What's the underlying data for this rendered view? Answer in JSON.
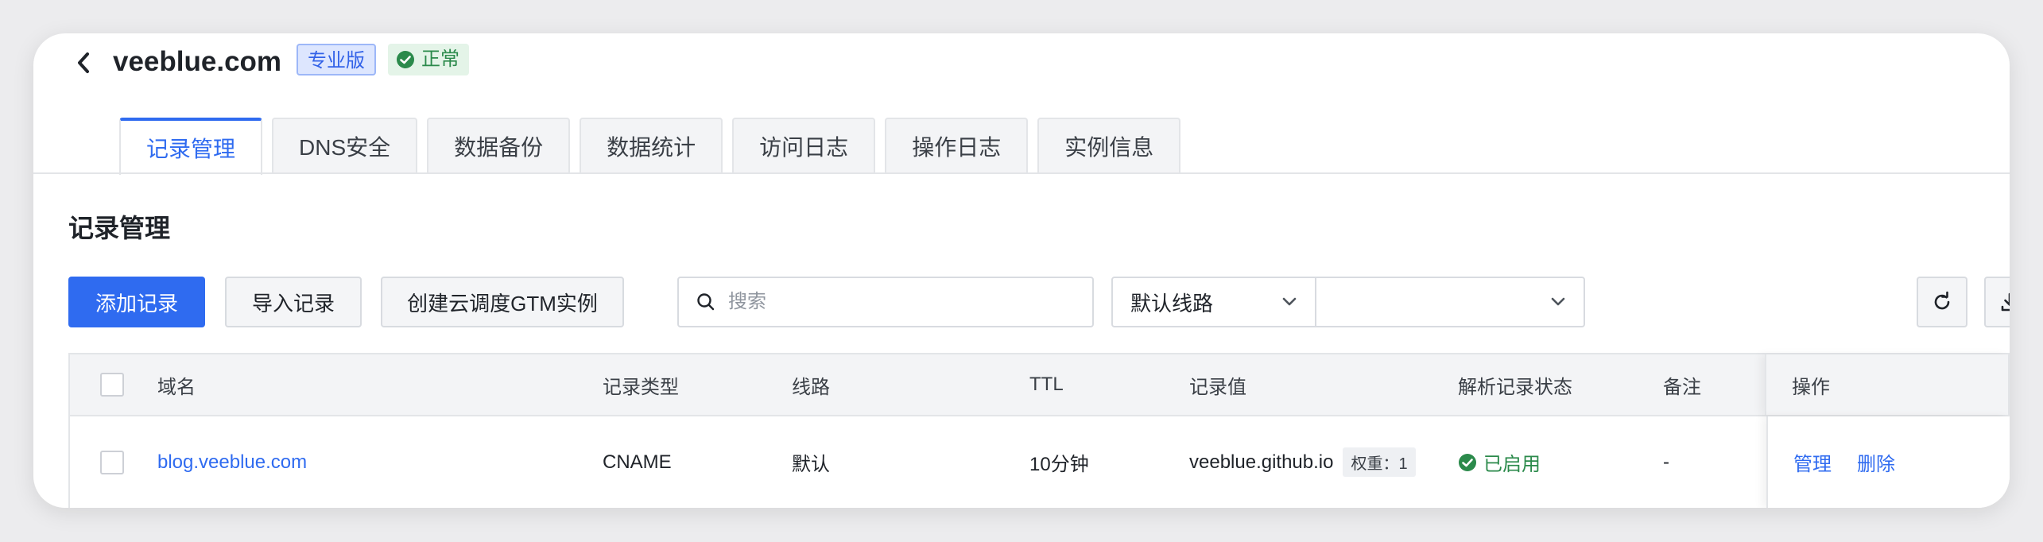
{
  "header": {
    "title": "veeblue.com",
    "edition_badge": "专业版",
    "status_badge": "正常"
  },
  "tabs": [
    {
      "label": "记录管理",
      "active": true
    },
    {
      "label": "DNS安全"
    },
    {
      "label": "数据备份"
    },
    {
      "label": "数据统计"
    },
    {
      "label": "访问日志"
    },
    {
      "label": "操作日志"
    },
    {
      "label": "实例信息"
    }
  ],
  "section": {
    "title": "记录管理"
  },
  "toolbar": {
    "add_label": "添加记录",
    "import_label": "导入记录",
    "gtm_label": "创建云调度GTM实例",
    "search_placeholder": "搜索",
    "line_select": "默认线路",
    "type_select": ""
  },
  "table": {
    "columns": [
      "域名",
      "记录类型",
      "线路",
      "TTL",
      "记录值",
      "解析记录状态",
      "备注",
      "操作"
    ],
    "rows": [
      {
        "domain": "blog.veeblue.com",
        "type": "CNAME",
        "line": "默认",
        "ttl": "10分钟",
        "value": "veeblue.github.io",
        "weight": "权重：1",
        "status": "已启用",
        "remark": "-",
        "manage": "管理",
        "delete": "删除"
      }
    ]
  },
  "colors": {
    "primary": "#2f6bf0",
    "success": "#2b8a4b",
    "edition_bg": "#dde6fe"
  },
  "icons": [
    "back-chevron-icon",
    "check-circle-icon",
    "search-icon",
    "chevron-down-icon",
    "refresh-icon",
    "download-icon"
  ]
}
